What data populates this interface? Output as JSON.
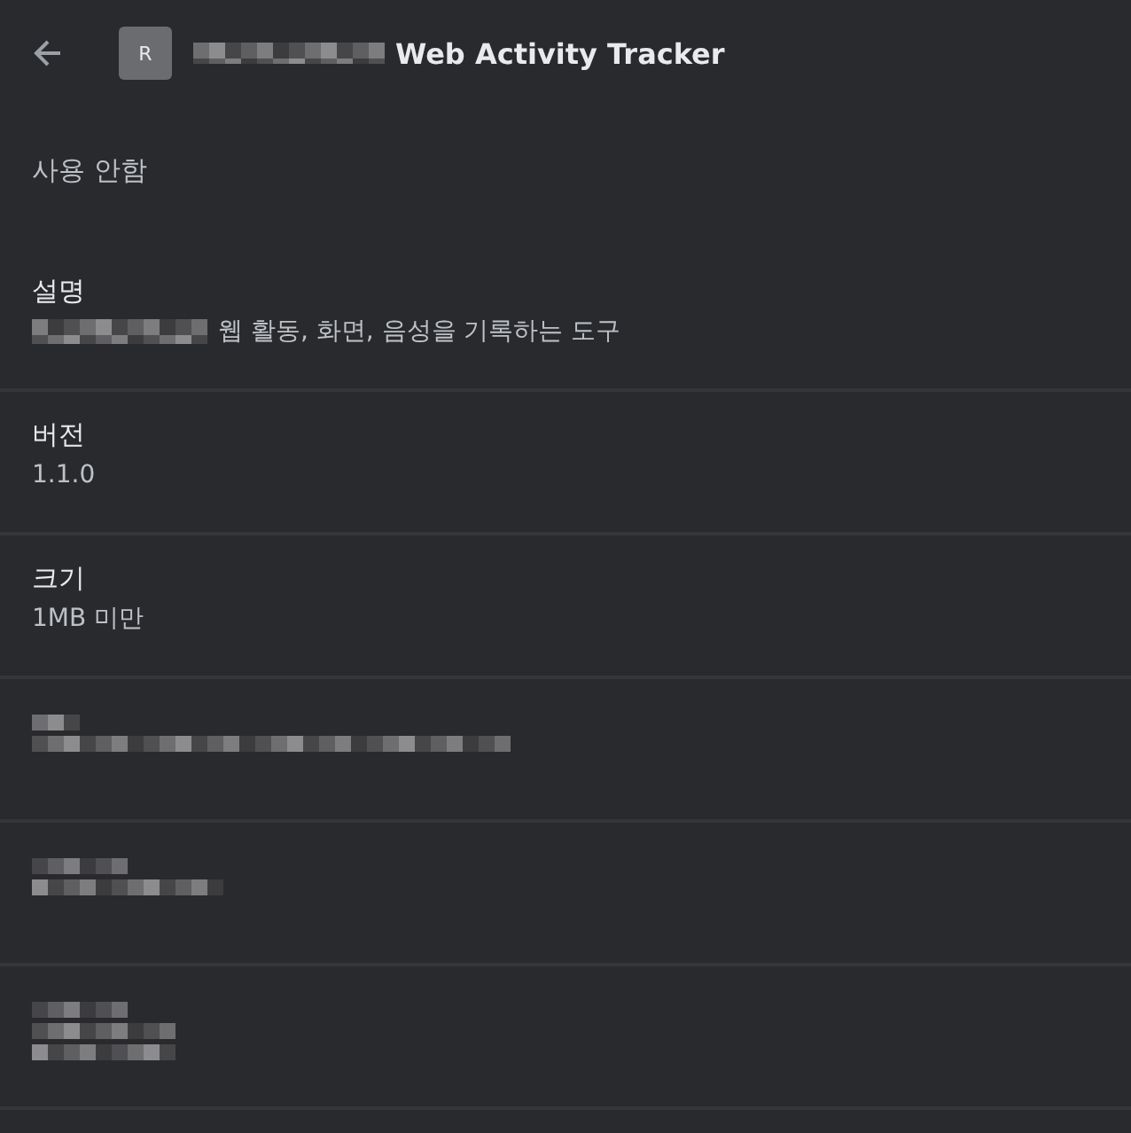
{
  "header": {
    "icon_letter": "R",
    "title_redacted_prefix": true,
    "title": "Web Activity Tracker"
  },
  "status": "사용 안함",
  "sections": [
    {
      "kind": "field",
      "label": "설명",
      "value_redacted_prefix": true,
      "value": "웹 활동, 화면, 음성을 기록하는 도구"
    },
    {
      "kind": "field",
      "label": "버전",
      "value_redacted_prefix": false,
      "value": "1.1.0"
    },
    {
      "kind": "field",
      "label": "크기",
      "value_redacted_prefix": false,
      "value": "1MB 미만"
    },
    {
      "kind": "redacted"
    },
    {
      "kind": "redacted"
    },
    {
      "kind": "redacted"
    }
  ]
}
